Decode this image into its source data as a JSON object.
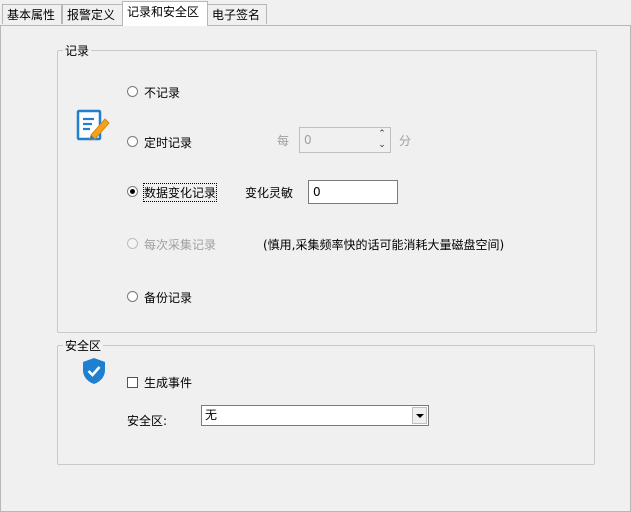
{
  "tabs": [
    {
      "label": "基本属性"
    },
    {
      "label": "报警定义"
    },
    {
      "label": "记录和安全区"
    },
    {
      "label": "电子签名"
    }
  ],
  "record_group": {
    "title": "记录",
    "options": {
      "none": "不记录",
      "timed": "定时记录",
      "on_change": "数据变化记录",
      "each_sample": "每次采集记录",
      "backup": "备份记录"
    },
    "timed_prefix": "每",
    "timed_value": "0",
    "timed_unit": "分",
    "sensitivity_label": "变化灵敏",
    "sensitivity_value": "0",
    "each_sample_note": "(慎用,采集频率快的话可能消耗大量磁盘空间)"
  },
  "security_group": {
    "title": "安全区",
    "event_checkbox_label": "生成事件",
    "zone_label": "安全区:",
    "zone_value": "无"
  },
  "colors": {
    "shield": "#1f7fd0",
    "icon_blue": "#1f7fd0",
    "icon_orange": "#f4a21b"
  }
}
